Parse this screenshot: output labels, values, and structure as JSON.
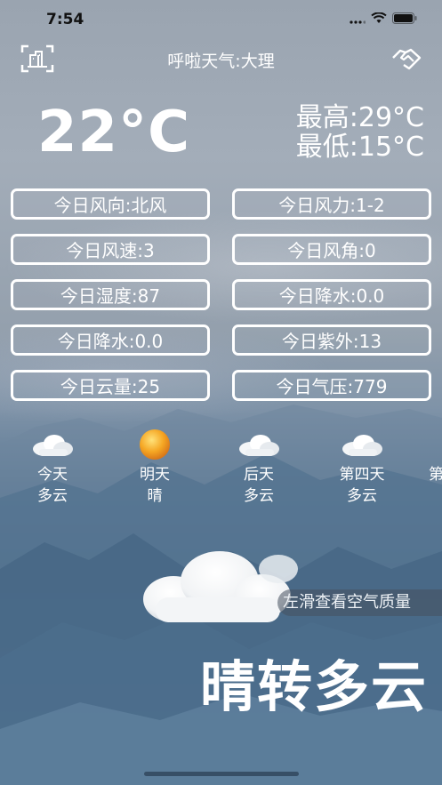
{
  "status_bar": {
    "time": "7:54"
  },
  "header": {
    "title": "呼啦天气:大理",
    "left_icon": "building-scan-icon",
    "right_icon": "handshake-icon"
  },
  "current": {
    "temperature": "22°C",
    "high": "最高:29°C",
    "low": "最低:15°C"
  },
  "stats": [
    "今日风向:北风",
    "今日风力:1-2",
    "今日风速:3",
    "今日风角:0",
    "今日湿度:87",
    "今日降水:0.0",
    "今日降水:0.0",
    "今日紫外:13",
    "今日云量:25",
    "今日气压:779"
  ],
  "forecast": [
    {
      "day": "今天",
      "condition": "多云",
      "icon": "cloud-icon"
    },
    {
      "day": "明天",
      "condition": "晴",
      "icon": "sun-icon"
    },
    {
      "day": "后天",
      "condition": "多云",
      "icon": "cloud-icon"
    },
    {
      "day": "第四天",
      "condition": "多云",
      "icon": "cloud-icon"
    },
    {
      "day": "第",
      "condition": "",
      "icon": ""
    }
  ],
  "swipe_hint": "左滑查看空气质量",
  "weather_summary": "晴转多云",
  "colors": {
    "text": "#ffffff",
    "sun": "#f5a623"
  }
}
